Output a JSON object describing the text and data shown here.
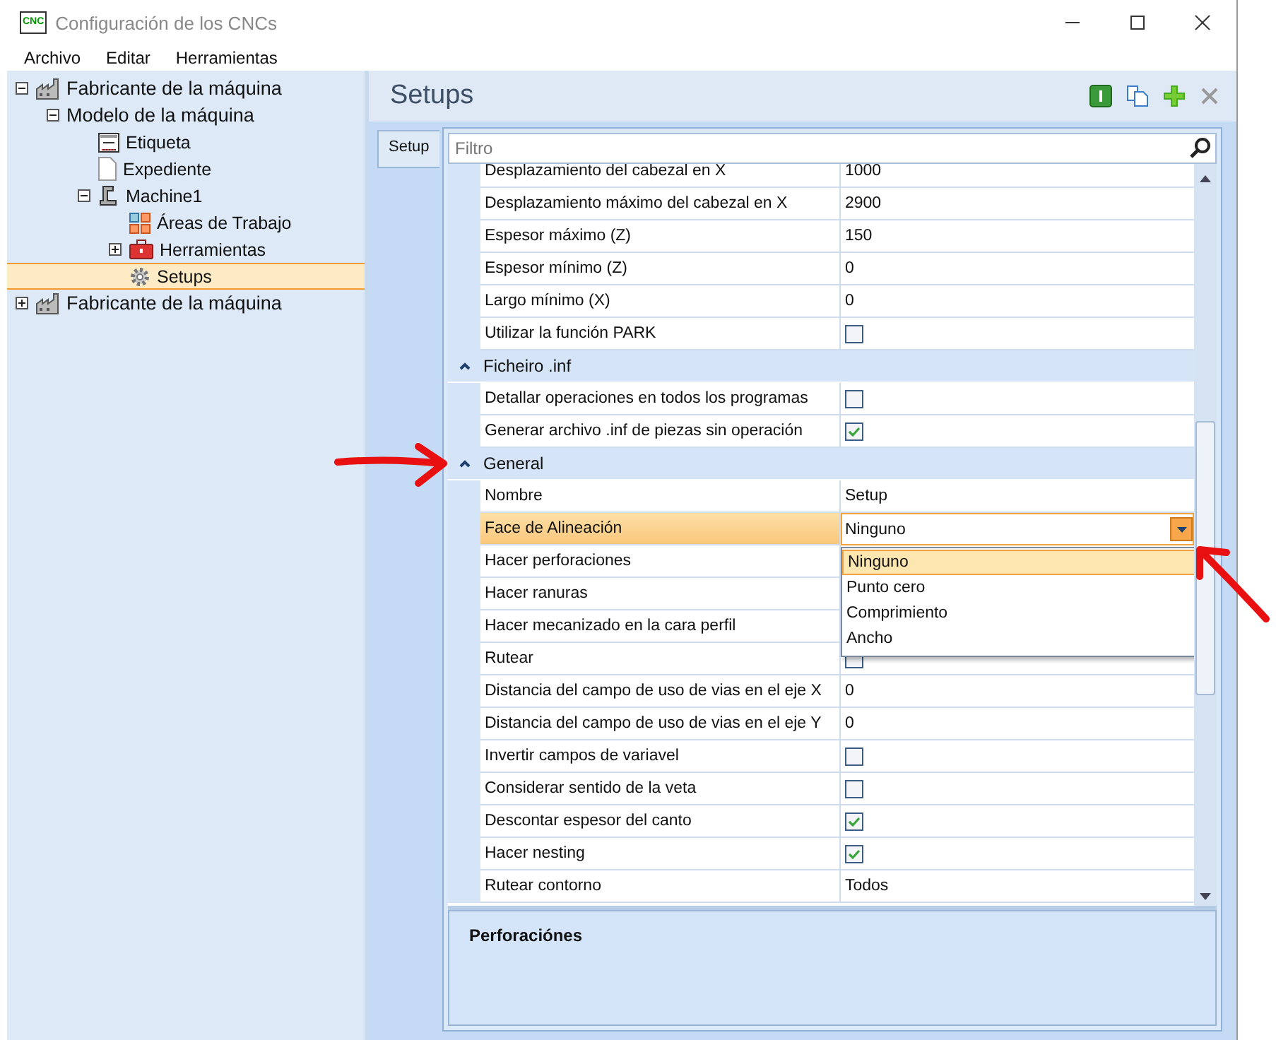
{
  "window": {
    "title": "Configuración de los CNCs",
    "logo": "CNC"
  },
  "menu": [
    "Archivo",
    "Editar",
    "Herramientas"
  ],
  "tree": [
    {
      "label": "Fabricante de la máquina",
      "kind": "factory",
      "expanded": true,
      "selected": false,
      "children": [
        {
          "label": "Modelo de la máquina",
          "expanded": true,
          "selected": false,
          "children": [
            {
              "label": "Etiqueta",
              "kind": "label",
              "selected": false
            },
            {
              "label": "Expediente",
              "kind": "file",
              "selected": false
            },
            {
              "label": "Machine1",
              "kind": "machine",
              "expanded": true,
              "selected": false,
              "children": [
                {
                  "label": "Áreas de Trabajo",
                  "kind": "areas",
                  "selected": false
                },
                {
                  "label": "Herramientas",
                  "kind": "tools",
                  "expanded": false,
                  "selected": false
                },
                {
                  "label": "Setups",
                  "kind": "setups",
                  "selected": true
                }
              ]
            }
          ]
        }
      ]
    },
    {
      "label": "Fabricante de la máquina",
      "kind": "factory",
      "expanded": false,
      "selected": false
    }
  ],
  "panel": {
    "title": "Setups",
    "tab": "Setup",
    "filter_placeholder": "Filtro"
  },
  "grid": [
    {
      "kind": "text",
      "name": "Desplazamiento del cabezal en X",
      "value": "1000",
      "selected": false
    },
    {
      "kind": "text",
      "name": "Desplazamiento máximo del cabezal en X",
      "value": "2900",
      "selected": false
    },
    {
      "kind": "text",
      "name": "Espesor máximo (Z)",
      "value": "150",
      "selected": false
    },
    {
      "kind": "text",
      "name": "Espesor mínimo (Z)",
      "value": "0",
      "selected": false
    },
    {
      "kind": "text",
      "name": "Largo mínimo (X)",
      "value": "0",
      "selected": false
    },
    {
      "kind": "checkbox",
      "name": "Utilizar la función PARK",
      "checked": false,
      "selected": false
    },
    {
      "kind": "section",
      "name": "Ficheiro .inf",
      "expanded": true
    },
    {
      "kind": "checkbox",
      "name": "Detallar operaciones en todos los programas",
      "checked": false,
      "selected": false
    },
    {
      "kind": "checkbox",
      "name": "Generar archivo .inf de piezas sin operación",
      "checked": true,
      "selected": false
    },
    {
      "kind": "section",
      "name": "General",
      "expanded": true
    },
    {
      "kind": "text",
      "name": "Nombre",
      "value": "Setup",
      "selected": false
    },
    {
      "kind": "combo",
      "name": "Face de Alineación",
      "value": "Ninguno",
      "selected": true,
      "open": true,
      "options": [
        {
          "label": "Ninguno",
          "selected": true
        },
        {
          "label": "Punto cero",
          "selected": false
        },
        {
          "label": "Comprimiento",
          "selected": false
        },
        {
          "label": "Ancho",
          "selected": false
        }
      ]
    },
    {
      "kind": "text",
      "name": "Hacer perforaciones",
      "selected": false
    },
    {
      "kind": "text",
      "name": "Hacer ranuras",
      "selected": false
    },
    {
      "kind": "text",
      "name": "Hacer mecanizado en la cara perfil",
      "selected": false
    },
    {
      "kind": "checkbox",
      "name": "Rutear",
      "checked": false,
      "selected": false
    },
    {
      "kind": "text",
      "name": "Distancia del campo de uso de vias en el eje X",
      "value": "0",
      "selected": false
    },
    {
      "kind": "text",
      "name": "Distancia del campo de uso de vias en el eje Y",
      "value": "0",
      "selected": false
    },
    {
      "kind": "checkbox",
      "name": "Invertir campos de variavel",
      "checked": false,
      "selected": false
    },
    {
      "kind": "checkbox",
      "name": "Considerar sentido de la veta",
      "checked": false,
      "selected": false
    },
    {
      "kind": "checkbox",
      "name": "Descontar espesor del canto",
      "checked": true,
      "selected": false
    },
    {
      "kind": "checkbox",
      "name": "Hacer nesting",
      "checked": true,
      "selected": false
    },
    {
      "kind": "text",
      "name": "Rutear contorno",
      "value": "Todos",
      "selected": false
    }
  ],
  "description": {
    "title": "Perforaciónes"
  }
}
